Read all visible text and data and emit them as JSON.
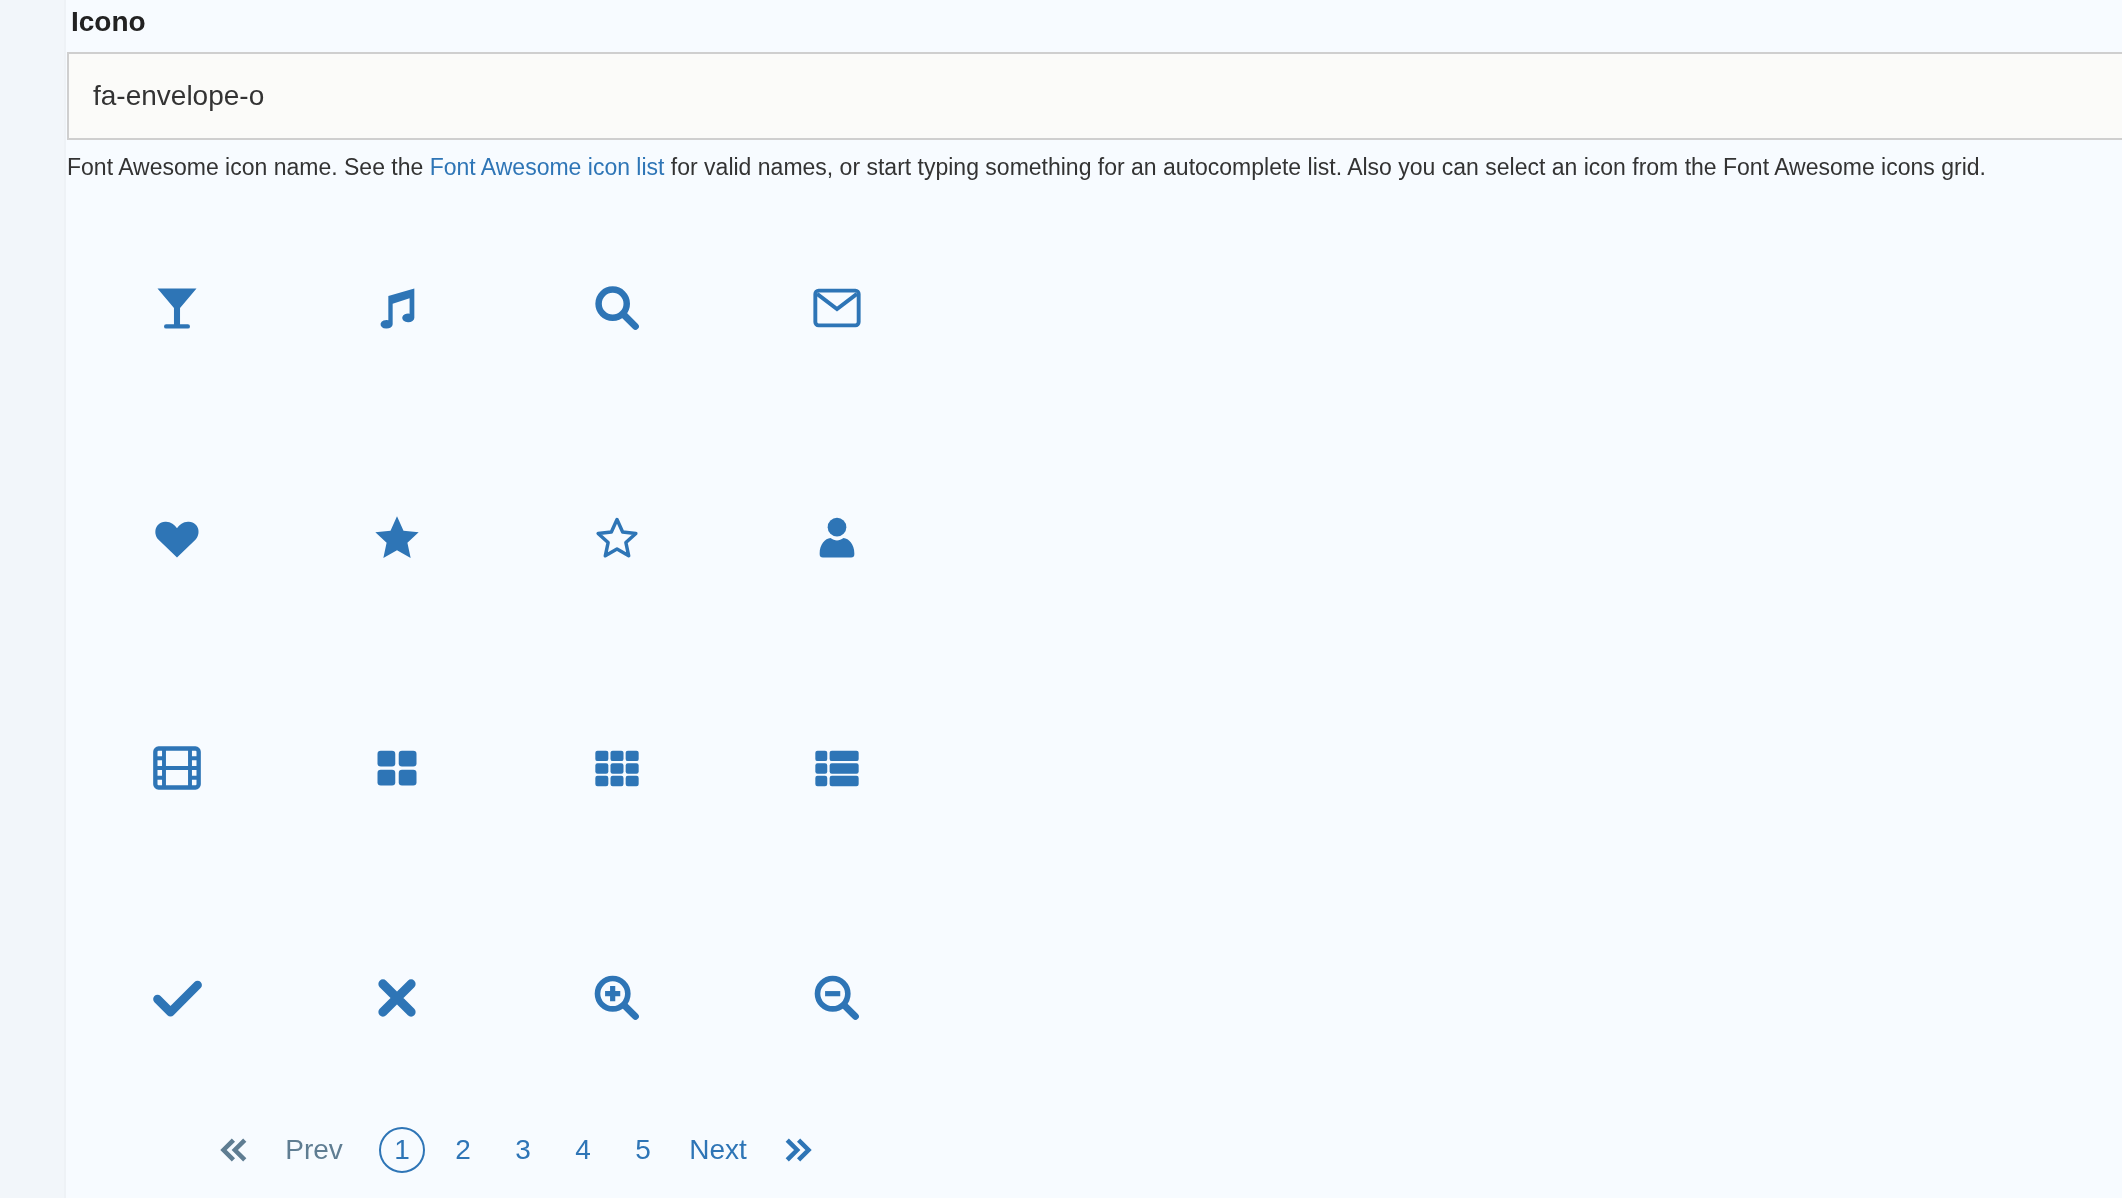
{
  "field": {
    "label": "Icono",
    "value": "fa-envelope-o"
  },
  "help": {
    "before": "Font Awesome icon name. See the ",
    "link": "Font Awesome icon list",
    "after": " for valid names, or start typing something for an autocomplete list. Also you can select an icon from the Font Awesome icons grid."
  },
  "icons": [
    {
      "kind": "glass"
    },
    {
      "kind": "music"
    },
    {
      "kind": "search"
    },
    {
      "kind": "envelope"
    },
    {
      "kind": "heart"
    },
    {
      "kind": "star"
    },
    {
      "kind": "star-outline"
    },
    {
      "kind": "user"
    },
    {
      "kind": "film"
    },
    {
      "kind": "grid-large"
    },
    {
      "kind": "grid"
    },
    {
      "kind": "list"
    },
    {
      "kind": "check"
    },
    {
      "kind": "cross"
    },
    {
      "kind": "zoom-in"
    },
    {
      "kind": "zoom-out"
    }
  ],
  "pagination": [
    {
      "kind": "first",
      "disabled": true
    },
    {
      "kind": "prev",
      "label": "Prev",
      "disabled": true
    },
    {
      "kind": "page",
      "label": "1",
      "selected": true
    },
    {
      "kind": "page",
      "label": "2",
      "selected": false
    },
    {
      "kind": "page",
      "label": "3",
      "selected": false
    },
    {
      "kind": "page",
      "label": "4",
      "selected": false
    },
    {
      "kind": "page",
      "label": "5",
      "selected": false
    },
    {
      "kind": "next",
      "label": "Next",
      "disabled": false
    },
    {
      "kind": "last",
      "disabled": false
    }
  ]
}
